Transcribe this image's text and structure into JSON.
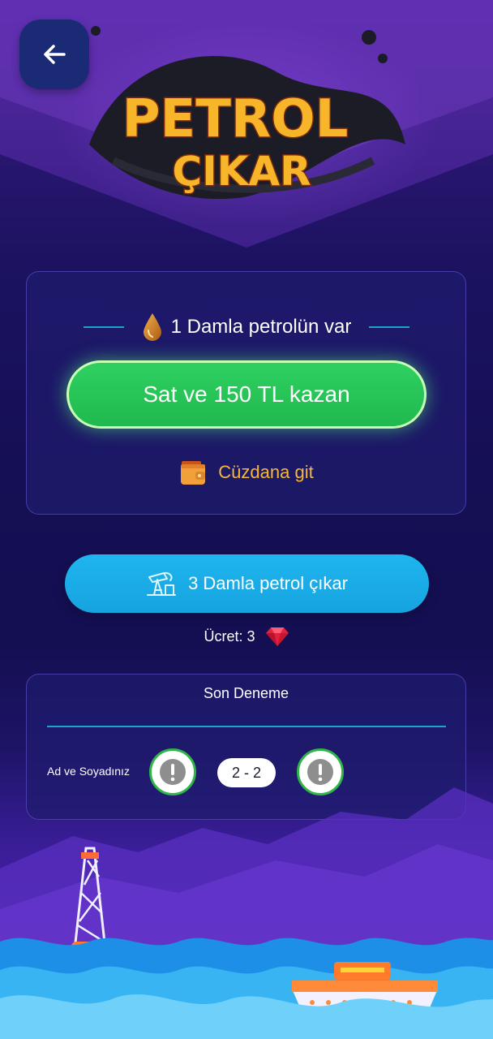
{
  "header": {
    "back_icon": "arrow-left-icon",
    "logo_line1": "PETROL",
    "logo_line2": "ÇIKAR"
  },
  "wallet_card": {
    "drop_icon": "oil-drop-icon",
    "have_text": "1 Damla petrolün var",
    "sell_label": "Sat ve 150 TL kazan",
    "wallet_icon": "wallet-icon",
    "wallet_link": "Cüzdana git"
  },
  "extract": {
    "pump_icon": "oil-pump-icon",
    "label": "3 Damla petrol çıkar",
    "fee_text": "Ücret: 3",
    "gem_icon": "ruby-gem-icon"
  },
  "last_attempt": {
    "title": "Son Deneme",
    "player_name": "Ad ve Soyadınız",
    "result_icon": "exclamation-icon",
    "score": "2 - 2"
  },
  "colors": {
    "green_button": "#2fd061",
    "blue_button": "#1fb5ee",
    "wallet_text": "#f6b73a",
    "accent_line": "#1ea4c8"
  }
}
